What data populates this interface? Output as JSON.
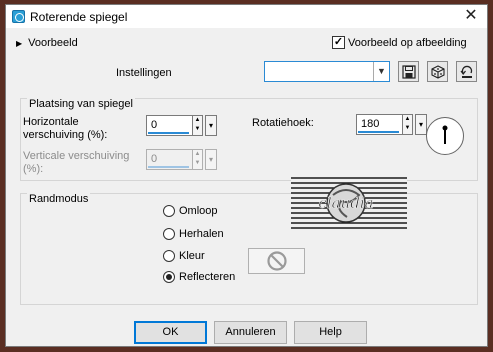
{
  "window": {
    "title": "Roterende spiegel",
    "close_glyph": "✕"
  },
  "preview": {
    "toggle_label": "Voorbeeld",
    "checkbox_label": "Voorbeeld op afbeelding",
    "checked": true
  },
  "settings": {
    "label": "Instellingen",
    "value": ""
  },
  "toolbar_icons": [
    "save-icon",
    "randomize-icon",
    "reset-icon"
  ],
  "mirror_group": {
    "title": "Plaatsing van spiegel",
    "horizontal_label_line1": "Horizontale",
    "horizontal_label_line2": "verschuiving (%):",
    "horizontal_value": "0",
    "vertical_label_line1": "Verticale verschuiving",
    "vertical_label_line2": "(%):",
    "vertical_value": "0",
    "rotation_label": "Rotatiehoek:",
    "rotation_value": "180"
  },
  "edge_group": {
    "title": "Randmodus",
    "options": [
      {
        "label": "Omloop",
        "selected": false
      },
      {
        "label": "Herhalen",
        "selected": false
      },
      {
        "label": "Kleur",
        "selected": false
      },
      {
        "label": "Reflecteren",
        "selected": true
      }
    ]
  },
  "watermark": {
    "text": "claudia"
  },
  "buttons": {
    "ok": "OK",
    "cancel": "Annuleren",
    "help": "Help"
  },
  "colors": {
    "accent": "#2a8ad4",
    "frame": "#5a2e22",
    "dialog": "#f0f0f0"
  }
}
